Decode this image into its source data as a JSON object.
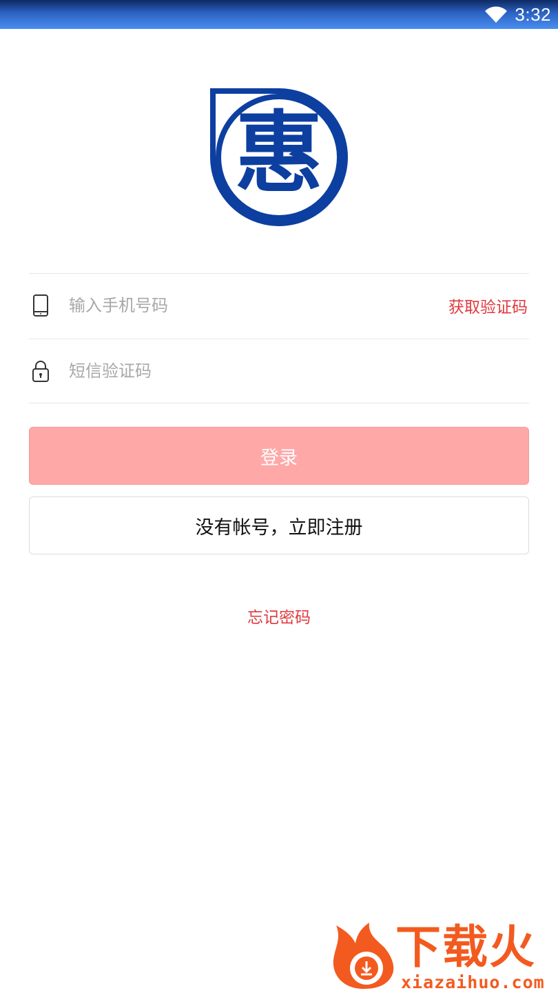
{
  "status_bar": {
    "time": "3:32",
    "wifi_icon": "wifi-icon"
  },
  "logo": {
    "glyph": "惠",
    "color": "#0d3fa0"
  },
  "phone_field": {
    "placeholder": "输入手机号码",
    "value": "",
    "icon": "phone-icon"
  },
  "get_code_label": "获取验证码",
  "sms_field": {
    "placeholder": "短信验证码",
    "value": "",
    "icon": "lock-icon"
  },
  "login_button": {
    "label": "登录"
  },
  "register_button": {
    "label": "没有帐号，立即注册"
  },
  "forgot_password": "忘记密码",
  "watermark": {
    "brand": "下载火",
    "url": "xiazaihuo.com"
  },
  "colors": {
    "accent": "#e0393e",
    "login_bg": "#ffa8a8",
    "watermark": "#f35a1f"
  }
}
